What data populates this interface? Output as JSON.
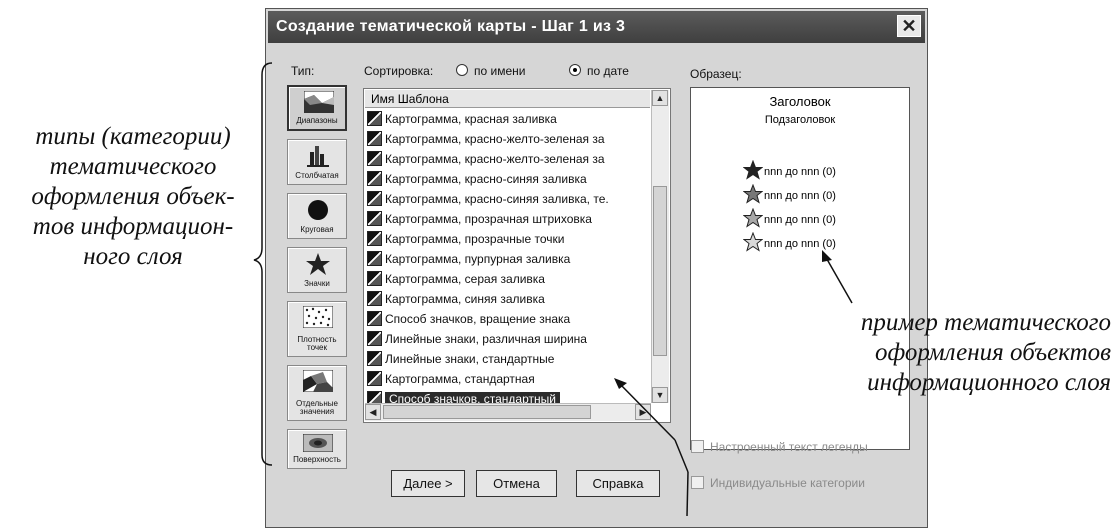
{
  "annotations": {
    "left_lines": [
      "типы (категории)",
      "тематического",
      "оформления объек-",
      "тов информацион-",
      "ного слоя"
    ],
    "right_lines": [
      "пример тематического",
      "оформления объектов",
      "информационного слоя"
    ]
  },
  "dialog": {
    "title": "Создание тематической карты - Шаг 1 из 3",
    "close_glyph": "✕",
    "type_label": "Тип:",
    "sort_label": "Сортировка:",
    "sort_by_name": "по имени",
    "sort_by_date": "по дате",
    "sort_selected": "по дате",
    "sample_label": "Образец:",
    "types": [
      {
        "label": "Диапазоны",
        "icon": "ranges-icon",
        "active": true
      },
      {
        "label": "Столбчатая",
        "icon": "bar-chart-icon",
        "active": false
      },
      {
        "label": "Круговая",
        "icon": "pie-chart-icon",
        "active": false
      },
      {
        "label": "Значки",
        "icon": "star-symbol-icon",
        "active": false
      },
      {
        "label": "Плотность точек",
        "icon": "dot-density-icon",
        "active": false
      },
      {
        "label": "Отдельные значения",
        "icon": "individual-values-icon",
        "active": false
      },
      {
        "label": "Поверхность",
        "icon": "surface-icon",
        "active": false
      }
    ],
    "list_header": "Имя Шаблона",
    "templates": [
      "Картограмма, красная заливка",
      "Картограмма, красно-желто-зеленая за",
      "Картограмма, красно-желто-зеленая за",
      "Картограмма, красно-синяя заливка",
      "Картограмма, красно-синяя заливка, те.",
      "Картограмма, прозрачная штриховка",
      "Картограмма, прозрачные точки",
      "Картограмма, пурпурная заливка",
      "Картограмма, серая заливка",
      "Картограмма, синяя заливка",
      "Способ значков, вращение знака",
      "Линейные знаки, различная ширина",
      "Линейные знаки, стандартные",
      "Картограмма, стандартная",
      "Способ значков, стандартный"
    ],
    "selected_template": "Способ значков, стандартный",
    "sample": {
      "title": "Заголовок",
      "subtitle": "Подзаголовок",
      "legend": [
        {
          "text": "nnn до nnn  (0)",
          "fill": "#222222"
        },
        {
          "text": "nnn до nnn  (0)",
          "fill": "#777777"
        },
        {
          "text": "nnn до nnn  (0)",
          "fill": "#a8a8a8"
        },
        {
          "text": "nnn до nnn  (0)",
          "fill": "#d8d8d8"
        }
      ]
    },
    "checkboxes": {
      "legend_text": "Настроенный текст легенды",
      "individual_categories": "Индивидуальные категории"
    },
    "buttons": {
      "next": "Далее >",
      "cancel": "Отмена",
      "help": "Справка"
    }
  }
}
